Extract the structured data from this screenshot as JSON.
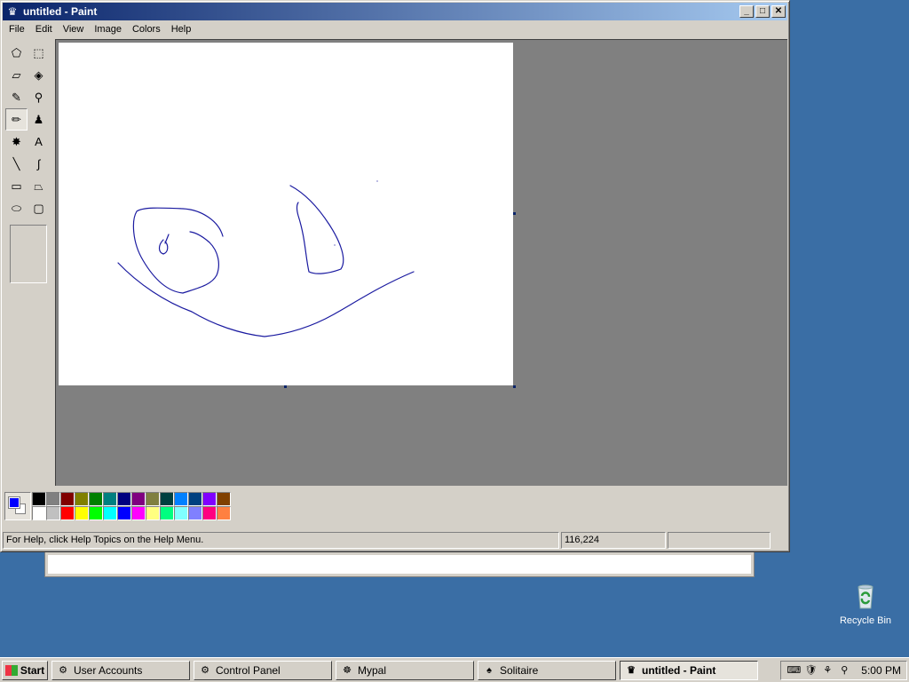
{
  "window": {
    "title": "untitled - Paint",
    "controls": {
      "minimize": "_",
      "maximize": "□",
      "close": "✕"
    }
  },
  "menu": [
    "File",
    "Edit",
    "View",
    "Image",
    "Colors",
    "Help"
  ],
  "tools": [
    {
      "name": "free-form-select-icon",
      "glyph": "⬠"
    },
    {
      "name": "select-icon",
      "glyph": "⬚"
    },
    {
      "name": "eraser-icon",
      "glyph": "▱"
    },
    {
      "name": "fill-bucket-icon",
      "glyph": "◈"
    },
    {
      "name": "color-picker-icon",
      "glyph": "✎"
    },
    {
      "name": "magnifier-icon",
      "glyph": "⚲"
    },
    {
      "name": "pencil-icon",
      "glyph": "✏",
      "selected": true
    },
    {
      "name": "brush-icon",
      "glyph": "♟"
    },
    {
      "name": "airbrush-icon",
      "glyph": "✸"
    },
    {
      "name": "text-icon",
      "glyph": "A"
    },
    {
      "name": "line-icon",
      "glyph": "╲"
    },
    {
      "name": "curve-icon",
      "glyph": "∫"
    },
    {
      "name": "rectangle-icon",
      "glyph": "▭"
    },
    {
      "name": "polygon-icon",
      "glyph": "⏢"
    },
    {
      "name": "ellipse-icon",
      "glyph": "⬭"
    },
    {
      "name": "rounded-rectangle-icon",
      "glyph": "▢"
    }
  ],
  "palette": {
    "foreground": "#0000ff",
    "background": "#ffffff",
    "colors_top": [
      "#000000",
      "#808080",
      "#800000",
      "#808000",
      "#008000",
      "#008080",
      "#000080",
      "#800080",
      "#808040",
      "#004040",
      "#0080ff",
      "#004080",
      "#8000ff",
      "#804000"
    ],
    "colors_bottom": [
      "#ffffff",
      "#c0c0c0",
      "#ff0000",
      "#ffff00",
      "#00ff00",
      "#00ffff",
      "#0000ff",
      "#ff00ff",
      "#ffff80",
      "#00ff80",
      "#80ffff",
      "#8080ff",
      "#ff0080",
      "#ff8040"
    ]
  },
  "status": {
    "help_text": "For Help, click Help Topics on the Help Menu.",
    "coords": "116,224",
    "size": ""
  },
  "desktop": {
    "recycle_bin": "Recycle Bin"
  },
  "taskbar": {
    "start": "Start",
    "items": [
      {
        "label": "User Accounts",
        "icon": "control-panel-icon",
        "glyph": "⚙",
        "active": false
      },
      {
        "label": "Control Panel",
        "icon": "control-panel-icon",
        "glyph": "⚙",
        "active": false
      },
      {
        "label": "Mypal",
        "icon": "mypal-icon",
        "glyph": "☸",
        "active": false
      },
      {
        "label": "Solitaire",
        "icon": "solitaire-icon",
        "glyph": "♠",
        "active": false
      },
      {
        "label": "untitled - Paint",
        "icon": "paint-icon",
        "glyph": "♛",
        "active": true
      }
    ],
    "clock": "5:00 PM"
  },
  "colors": {
    "desktop": "#3a6ea5",
    "title_active": "#0a246a",
    "stroke": "#1a1aa0"
  }
}
